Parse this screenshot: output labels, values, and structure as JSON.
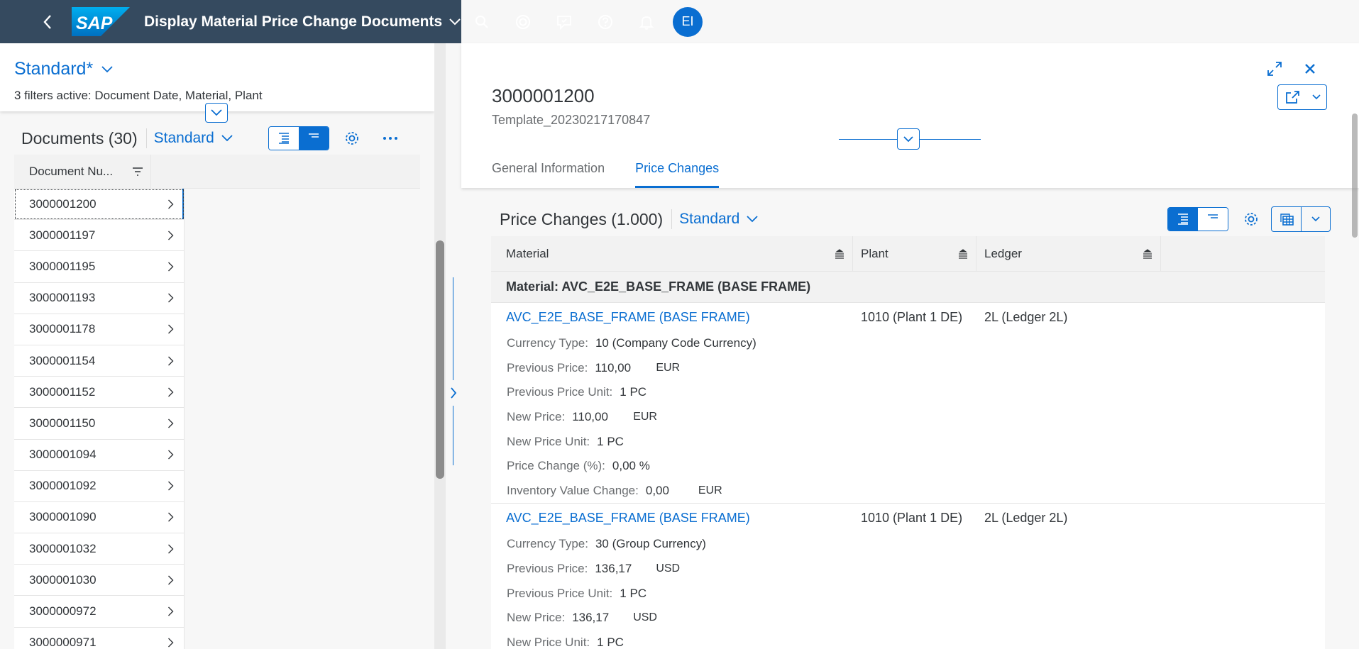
{
  "shell": {
    "title": "Display Material Price Change Documents",
    "logo_text": "SAP",
    "avatar_initials": "EI"
  },
  "variant": {
    "name": "Standard",
    "modified_marker": "*",
    "filters_text": "3 filters active: Document Date, Material, Plant"
  },
  "documents": {
    "title": "Documents (30)",
    "variant": "Standard",
    "column_header": "Document Nu...",
    "rows": [
      "3000001200",
      "3000001197",
      "3000001195",
      "3000001193",
      "3000001178",
      "3000001154",
      "3000001152",
      "3000001150",
      "3000001094",
      "3000001092",
      "3000001090",
      "3000001032",
      "3000001030",
      "3000000972",
      "3000000971"
    ]
  },
  "object": {
    "id": "3000001200",
    "subtitle": "Template_20230217170847",
    "tabs": [
      "General Information",
      "Price Changes"
    ],
    "active_tab": "Price Changes"
  },
  "price_changes": {
    "title": "Price Changes (1.000)",
    "variant": "Standard",
    "columns": [
      "Material",
      "Plant",
      "Ledger"
    ],
    "group_header": "Material: AVC_E2E_BASE_FRAME (BASE FRAME)",
    "rows": [
      {
        "material": "AVC_E2E_BASE_FRAME (BASE FRAME)",
        "plant": "1010 (Plant 1 DE)",
        "ledger": "2L (Ledger 2L)",
        "currency_type_label": "Currency Type:",
        "currency_type": "10 (Company Code Currency)",
        "prev_price_label": "Previous Price:",
        "prev_price": "110,00",
        "prev_price_cur": "EUR",
        "prev_unit_label": "Previous Price Unit:",
        "prev_unit": "1 PC",
        "new_price_label": "New Price:",
        "new_price": "110,00",
        "new_price_cur": "EUR",
        "new_unit_label": "New Price Unit:",
        "new_unit": "1 PC",
        "change_label": "Price Change (%):",
        "change": "0,00 %",
        "inv_label": "Inventory Value Change:",
        "inv": "0,00",
        "inv_cur": "EUR"
      },
      {
        "material": "AVC_E2E_BASE_FRAME (BASE FRAME)",
        "plant": "1010 (Plant 1 DE)",
        "ledger": "2L (Ledger 2L)",
        "currency_type_label": "Currency Type:",
        "currency_type": "30 (Group Currency)",
        "prev_price_label": "Previous Price:",
        "prev_price": "136,17",
        "prev_price_cur": "USD",
        "prev_unit_label": "Previous Price Unit:",
        "prev_unit": "1 PC",
        "new_price_label": "New Price:",
        "new_price": "136,17",
        "new_price_cur": "USD",
        "new_unit_label": "New Price Unit:",
        "new_unit": "1 PC"
      }
    ]
  }
}
